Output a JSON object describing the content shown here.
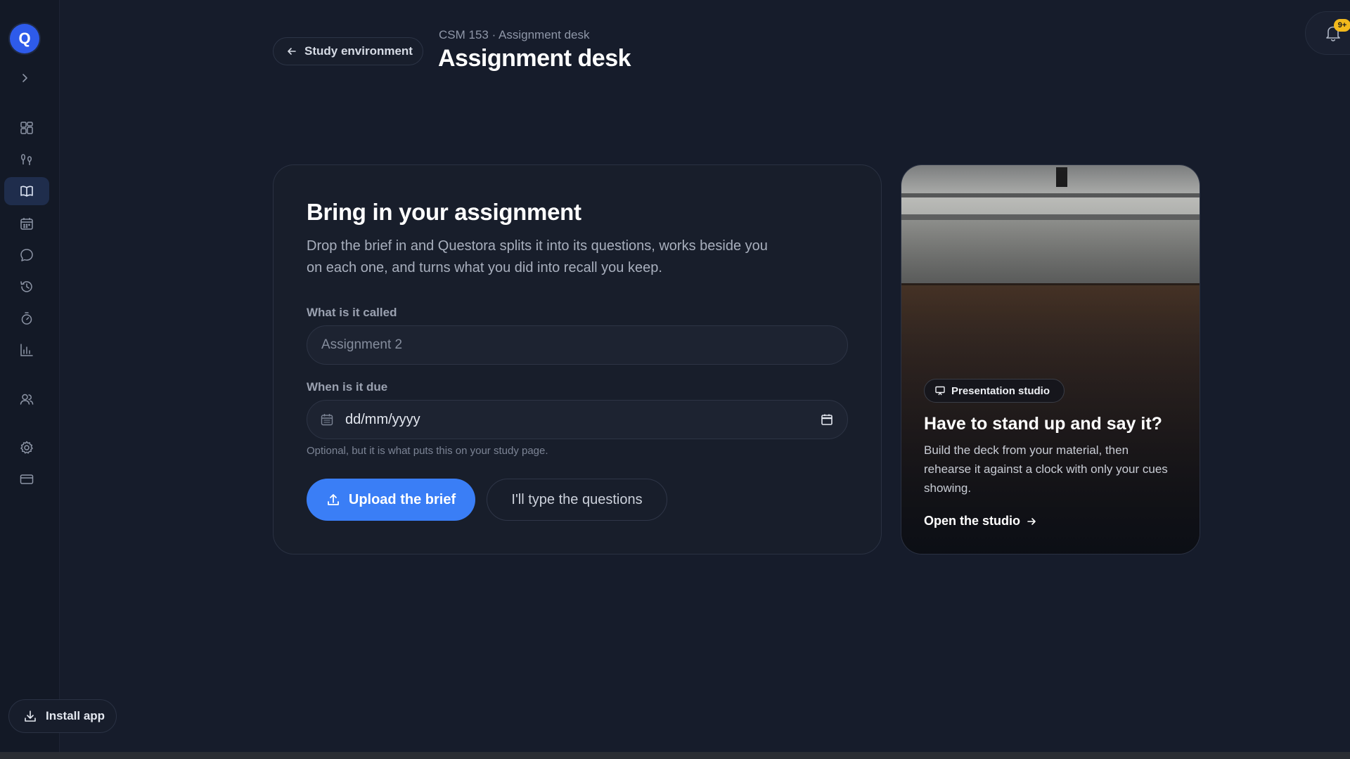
{
  "app": {
    "logo_letter": "Q",
    "brand_color": "#2e5bea",
    "accent": "#3a7ef6"
  },
  "sidebar": {
    "items": [
      {
        "name": "dashboard-grid-icon"
      },
      {
        "name": "practice-icon"
      },
      {
        "name": "book-icon",
        "active": true
      },
      {
        "name": "calendar-icon"
      },
      {
        "name": "chat-icon"
      },
      {
        "name": "history-icon"
      },
      {
        "name": "timer-icon"
      },
      {
        "name": "bar-chart-icon"
      },
      {
        "name": "users-icon"
      },
      {
        "name": "settings-icon"
      },
      {
        "name": "credit-card-icon"
      }
    ],
    "install_label": "Install app"
  },
  "header": {
    "back_label": "Study environment",
    "breadcrumb": "CSM 153 · Assignment desk",
    "title": "Assignment desk",
    "notification_badge": "9+"
  },
  "assignment_card": {
    "title": "Bring in your assignment",
    "description": "Drop the brief in and Questora splits it into its questions, works beside you on each one, and turns what you did into recall you keep.",
    "name_label": "What is it called",
    "name_placeholder": "Assignment 2",
    "due_label": "When is it due",
    "due_value": "dd/mm/yyyy",
    "due_hint": "Optional, but it is what puts this on your study page.",
    "upload_label": "Upload the brief",
    "type_label": "I'll type the questions"
  },
  "promo": {
    "badge": "Presentation studio",
    "title": "Have to stand up and say it?",
    "text": "Build the deck from your material, then rehearse it against a clock with only your cues showing.",
    "link": "Open the studio"
  }
}
